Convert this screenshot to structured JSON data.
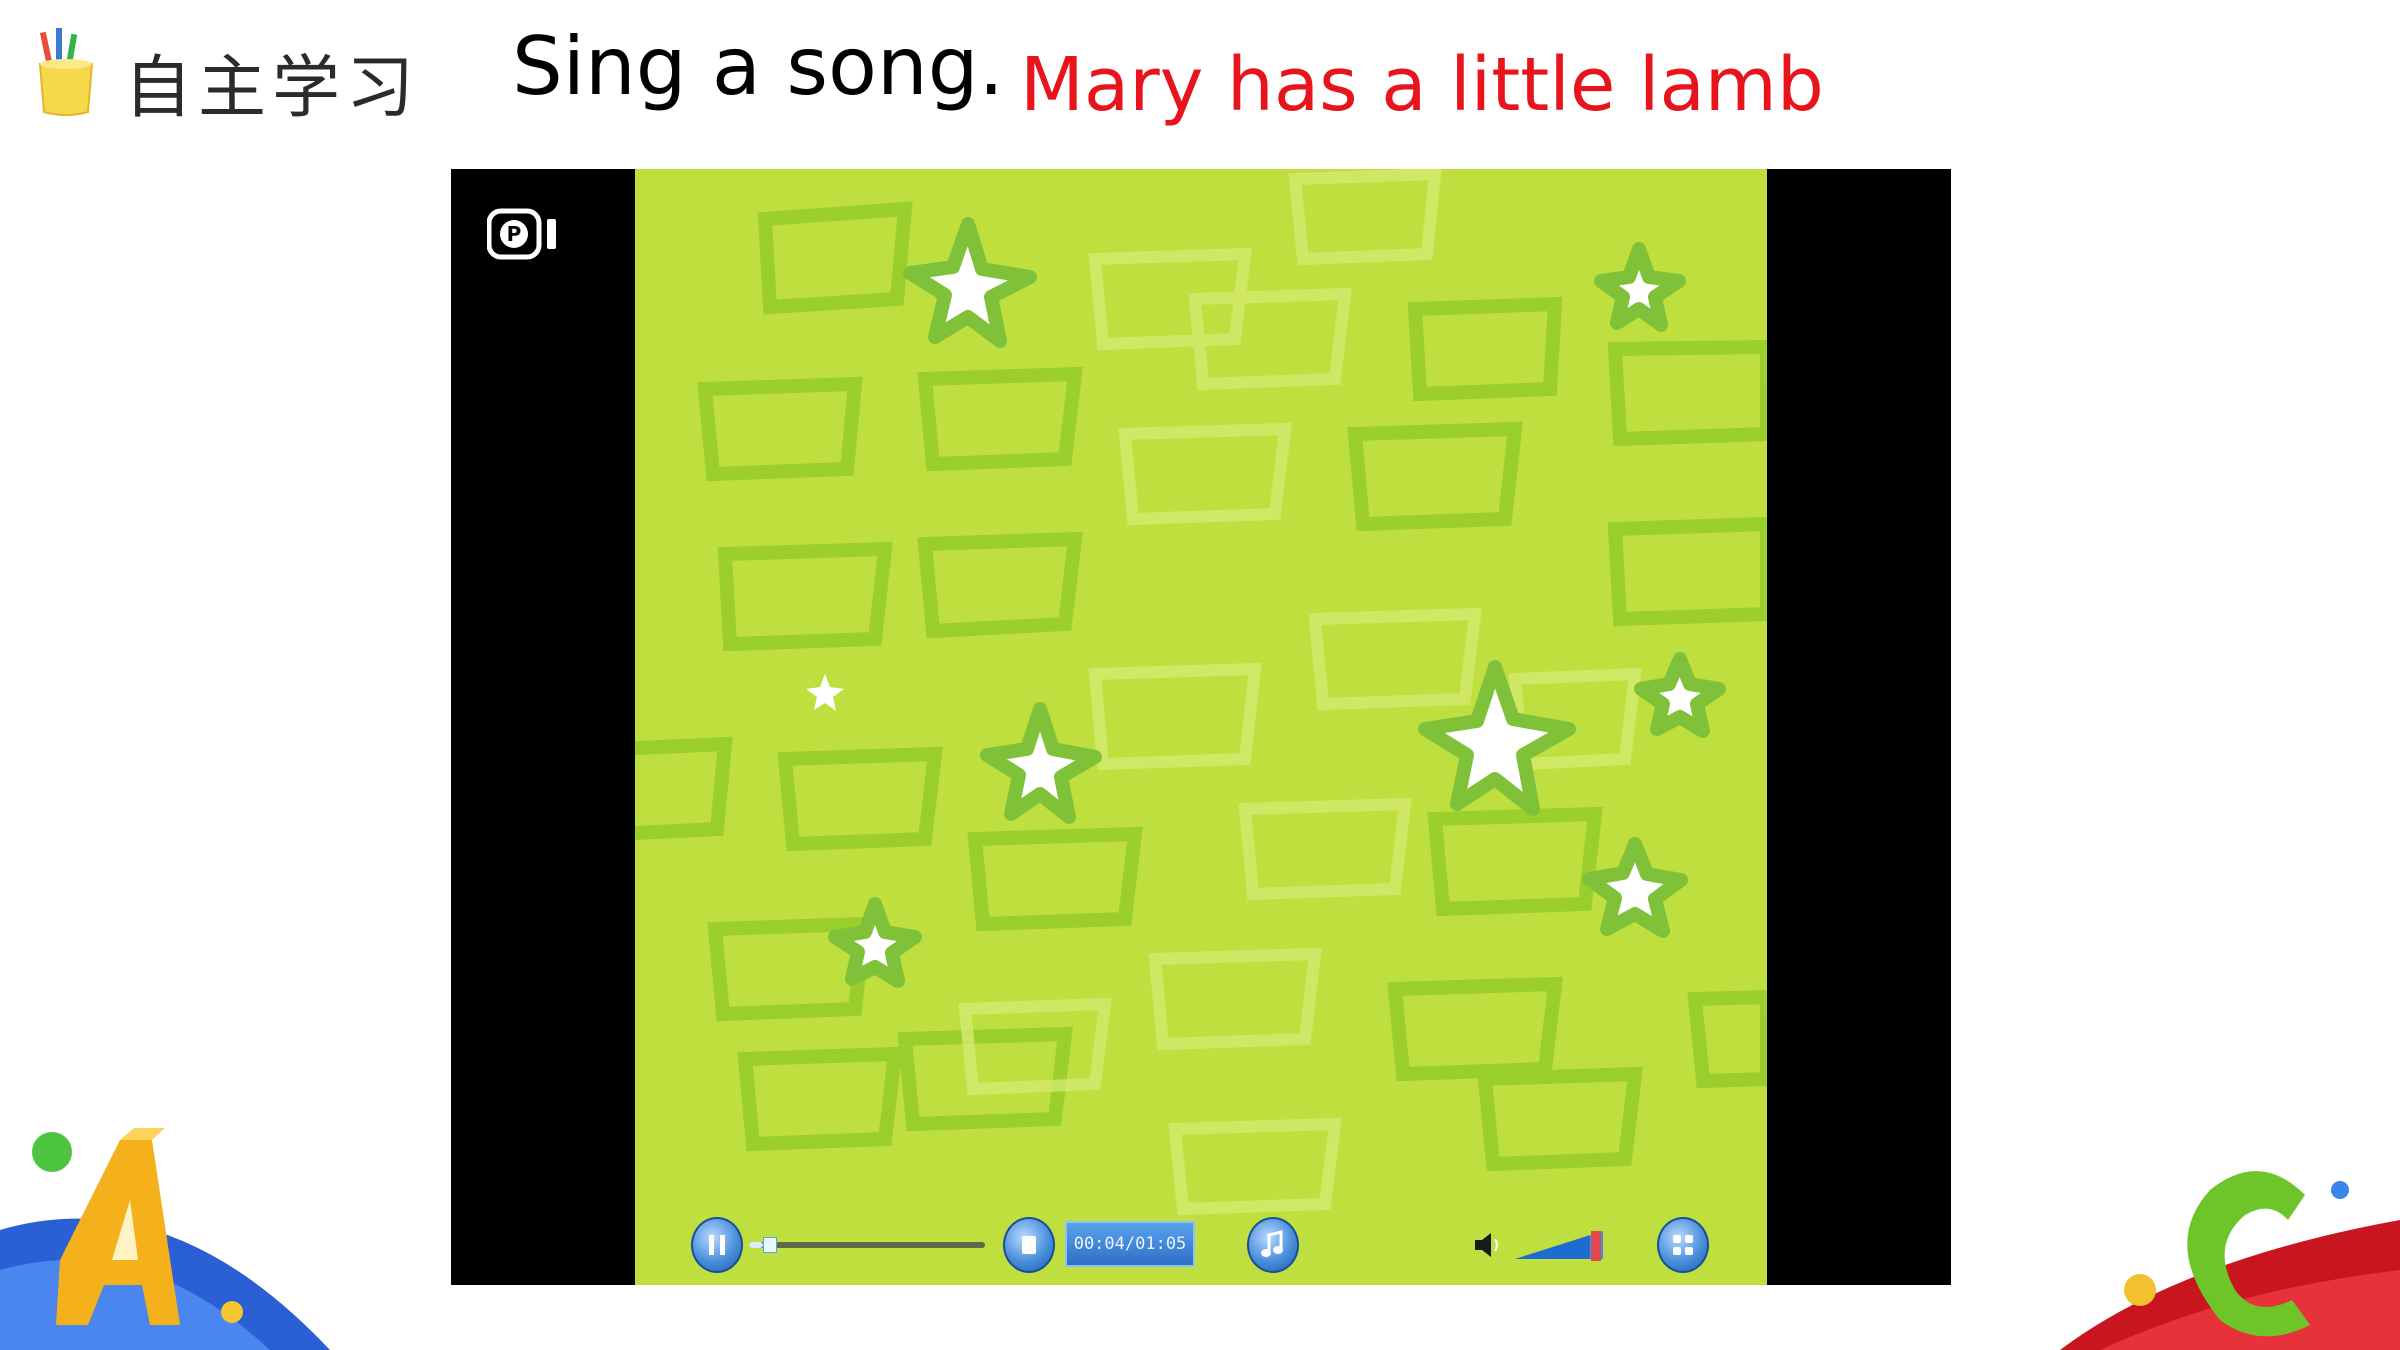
{
  "header": {
    "section_label": "自主学习",
    "instruction": "Sing a song.",
    "song_title": "Mary has a little lamb"
  },
  "player": {
    "time_readout": "00:04/01:05",
    "progress": 0.06,
    "volume": 0.85,
    "state": "playing"
  },
  "colors": {
    "song_title": "#e8141b",
    "video_background": "#bfdf3f",
    "control_blue": "#2e6fc7"
  },
  "icons": {
    "section": "pencil-cup-icon",
    "logo": "video-logo-icon",
    "pause": "pause-icon",
    "stop": "stop-icon",
    "music": "music-note-icon",
    "speaker": "speaker-icon",
    "fullscreen": "fullscreen-icon"
  }
}
